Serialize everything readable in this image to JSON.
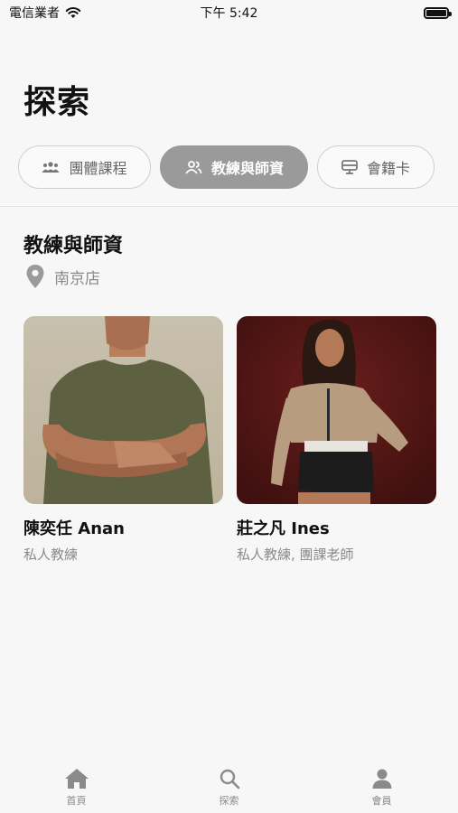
{
  "status": {
    "carrier": "電信業者",
    "time": "下午 5:42"
  },
  "page_title": "探索",
  "tabs": [
    {
      "label": "團體課程",
      "icon": "group-icon",
      "active": false
    },
    {
      "label": "教練與師資",
      "icon": "people-icon",
      "active": true
    },
    {
      "label": "會籍卡",
      "icon": "card-icon",
      "active": false
    }
  ],
  "section": {
    "title": "教練與師資",
    "location": "南京店",
    "location_icon": "location-pin-icon"
  },
  "coaches": [
    {
      "name": "陳奕任 Anan",
      "role": "私人教練"
    },
    {
      "name": "莊之凡 Ines",
      "role": "私人教練, 團課老師"
    }
  ],
  "tabbar": [
    {
      "label": "首頁",
      "icon": "home-icon"
    },
    {
      "label": "探索",
      "icon": "search-icon"
    },
    {
      "label": "會員",
      "icon": "person-icon"
    }
  ],
  "colors": {
    "active_tab": "#9a9a9a",
    "background": "#f7f7f7",
    "muted_text": "#8a8a8a"
  }
}
